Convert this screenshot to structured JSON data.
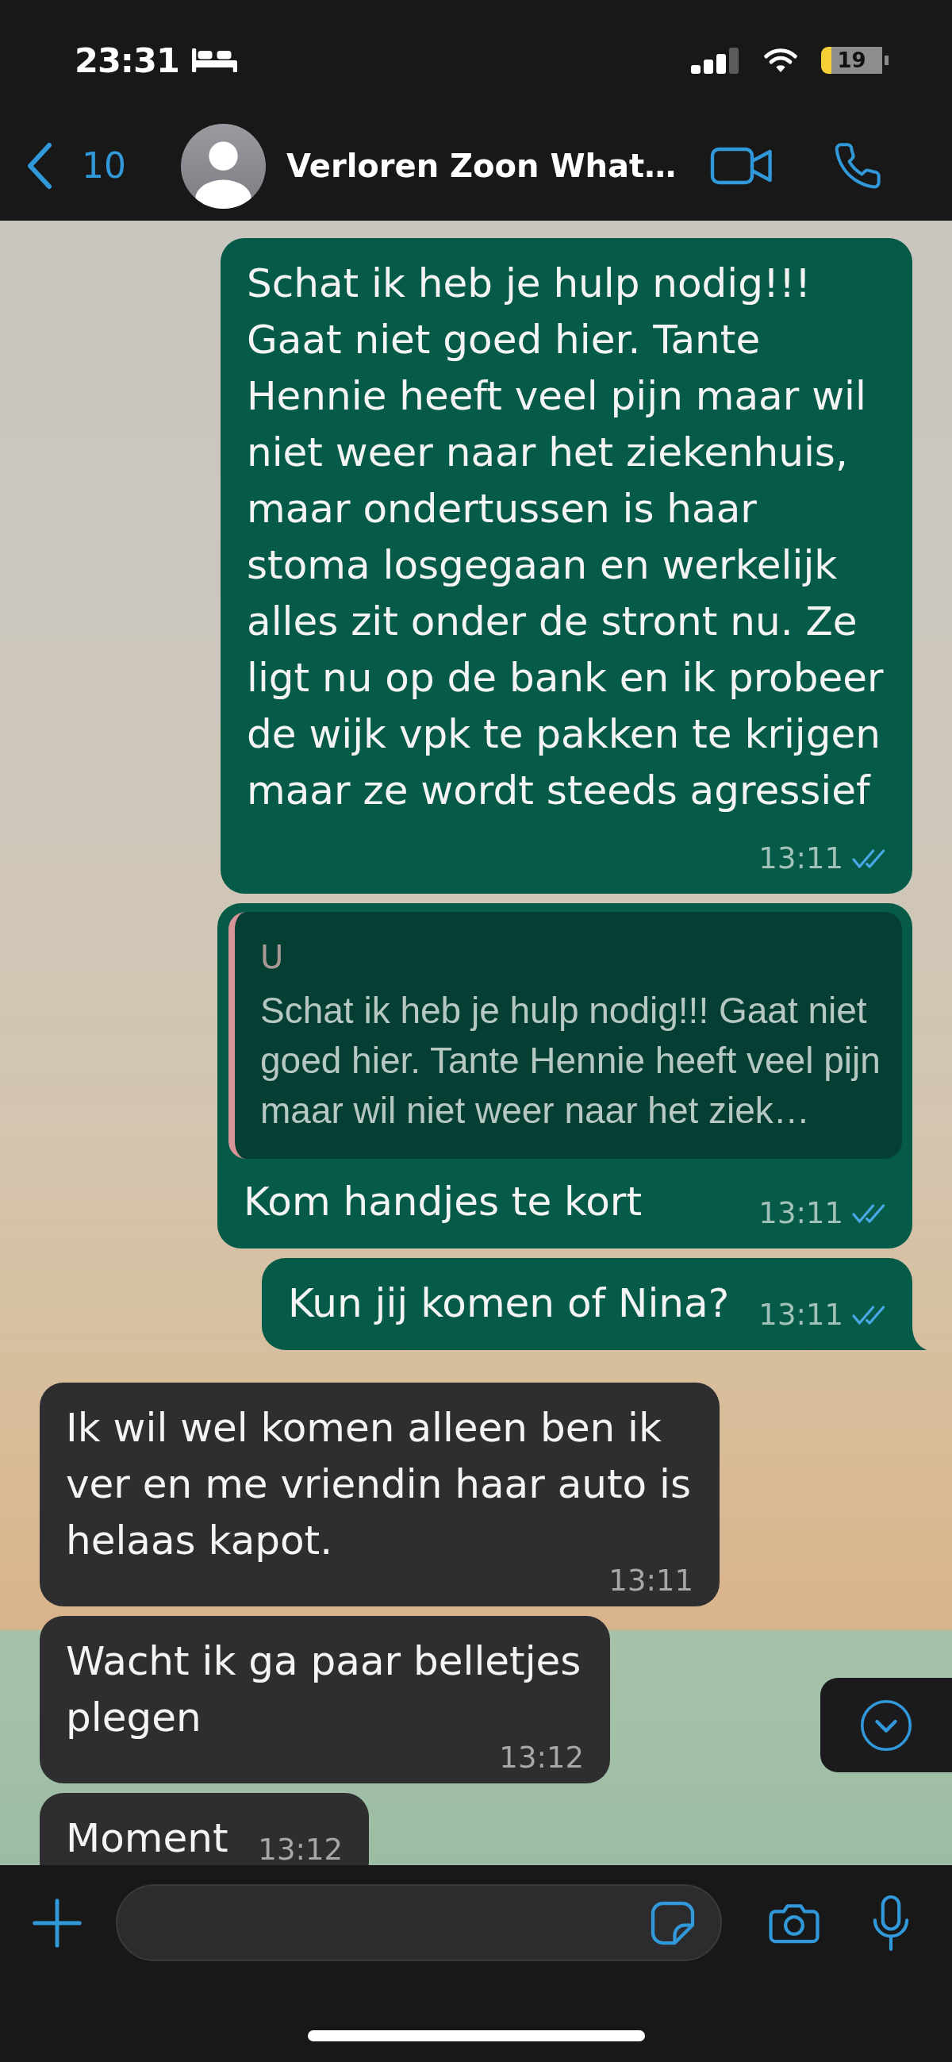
{
  "status_bar": {
    "time": "23:31",
    "battery": "19"
  },
  "header": {
    "back_label": "10",
    "title": "Verloren Zoon What…"
  },
  "messages": [
    {
      "kind": "outgoing",
      "text": "Schat ik heb je hulp nodig!!! Gaat niet goed hier. Tante Hennie heeft veel pijn maar wil niet weer naar het ziekenhuis, maar ondertussen is haar stoma losgegaan en werkelijk alles zit onder de stront nu. Ze ligt nu op de bank en ik probeer de wijk vpk te pakken te krijgen maar ze wordt steeds agressief",
      "time": "13:11",
      "read": true,
      "tail": false
    },
    {
      "kind": "outgoing",
      "quote": {
        "author": "U",
        "text": "Schat ik heb je hulp nodig!!! Gaat niet goed hier. Tante Hennie heeft veel pijn maar wil niet weer naar het ziek…"
      },
      "text": "Kom handjes te kort",
      "time": "13:11",
      "read": true,
      "tail": false
    },
    {
      "kind": "outgoing",
      "text": "Kun jij komen of Nina?",
      "time": "13:11",
      "read": true,
      "tail": true
    },
    {
      "kind": "incoming",
      "text": "Ik wil wel komen alleen ben ik ver en me vriendin haar auto is helaas kapot.",
      "time": "13:11",
      "tail": false
    },
    {
      "kind": "incoming",
      "text": "Wacht ik ga paar belletjes plegen",
      "time": "13:12",
      "tail": false
    },
    {
      "kind": "incoming",
      "text": "Moment",
      "time": "13:12",
      "tail": false
    }
  ]
}
